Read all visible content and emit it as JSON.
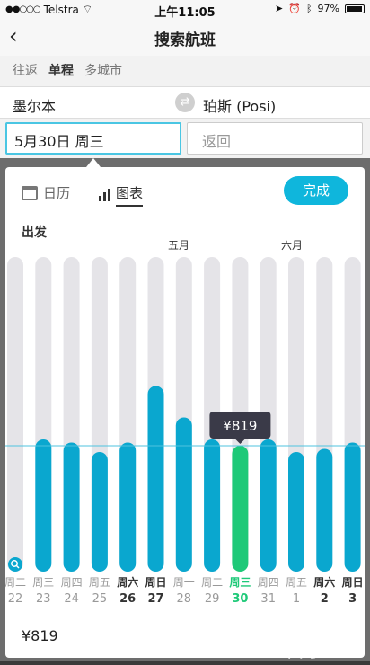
{
  "status_bar": {
    "carrier": "Telstra",
    "time": "上午11:05",
    "battery": "97%"
  },
  "nav": {
    "title": "搜索航班"
  },
  "trip_tabs": [
    {
      "label": "往返",
      "active": false
    },
    {
      "label": "单程",
      "active": true
    },
    {
      "label": "多城市",
      "active": false
    }
  ],
  "route": {
    "from": "墨尔本",
    "to": "珀斯 (Posi)"
  },
  "date_field": {
    "value": "5月30日 周三"
  },
  "return_field": {
    "placeholder": "返回"
  },
  "popup": {
    "calendar_tab": "日历",
    "chart_tab": "图表",
    "done_label": "完成",
    "depart_label": "出发",
    "months": [
      "五月",
      "六月"
    ],
    "selected_price": "¥819",
    "tooltip_price": "¥819"
  },
  "chart_data": {
    "type": "bar",
    "days": [
      {
        "weekday": "周二",
        "day": "22",
        "value": 0,
        "available": false
      },
      {
        "weekday": "周三",
        "day": "23",
        "value": 0.42,
        "available": true
      },
      {
        "weekday": "周四",
        "day": "24",
        "value": 0.41,
        "available": true
      },
      {
        "weekday": "周五",
        "day": "25",
        "value": 0.38,
        "available": true
      },
      {
        "weekday": "周六",
        "day": "26",
        "value": 0.41,
        "available": true
      },
      {
        "weekday": "周日",
        "day": "27",
        "value": 0.59,
        "available": true
      },
      {
        "weekday": "周一",
        "day": "28",
        "value": 0.49,
        "available": true
      },
      {
        "weekday": "周二",
        "day": "29",
        "value": 0.42,
        "available": true
      },
      {
        "weekday": "周三",
        "day": "30",
        "value": 0.4,
        "available": true,
        "selected": true
      },
      {
        "weekday": "周四",
        "day": "31",
        "value": 0.42,
        "available": true
      },
      {
        "weekday": "周五",
        "day": "1",
        "value": 0.38,
        "available": true
      },
      {
        "weekday": "周六",
        "day": "2",
        "value": 0.39,
        "available": true
      },
      {
        "weekday": "周日",
        "day": "3",
        "value": 0.41,
        "available": true
      }
    ],
    "colors": {
      "track": "#e5e4e8",
      "bar": "#0aa7cf",
      "selected": "#1ec978",
      "tooltip": "#3a3a48",
      "refline": "#4fc3df"
    }
  },
  "watermark": "留学360"
}
